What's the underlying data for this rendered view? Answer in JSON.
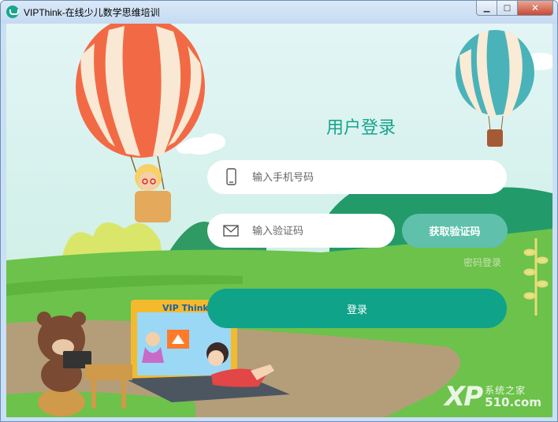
{
  "window": {
    "title": "VIPThink-在线少儿数学思维培训",
    "minimize_glyph": "▁",
    "maximize_glyph": "□",
    "close_glyph": "✕"
  },
  "login": {
    "title": "用户登录",
    "phone_placeholder": "输入手机号码",
    "code_placeholder": "输入验证码",
    "get_code_label": "获取验证码",
    "password_login_label": "密码登录",
    "submit_label": "登录"
  },
  "scene": {
    "laptop_brand": "VIP Think"
  },
  "watermark": {
    "logo": "XP",
    "site_name": "系统之家",
    "url": "510.com"
  },
  "colors": {
    "accent": "#0fa38a",
    "title": "#17a48b",
    "button_secondary": "#5fc1ab",
    "grass": "#6cc24a"
  },
  "icons": {
    "phone": "phone-icon",
    "code": "envelope-icon"
  }
}
